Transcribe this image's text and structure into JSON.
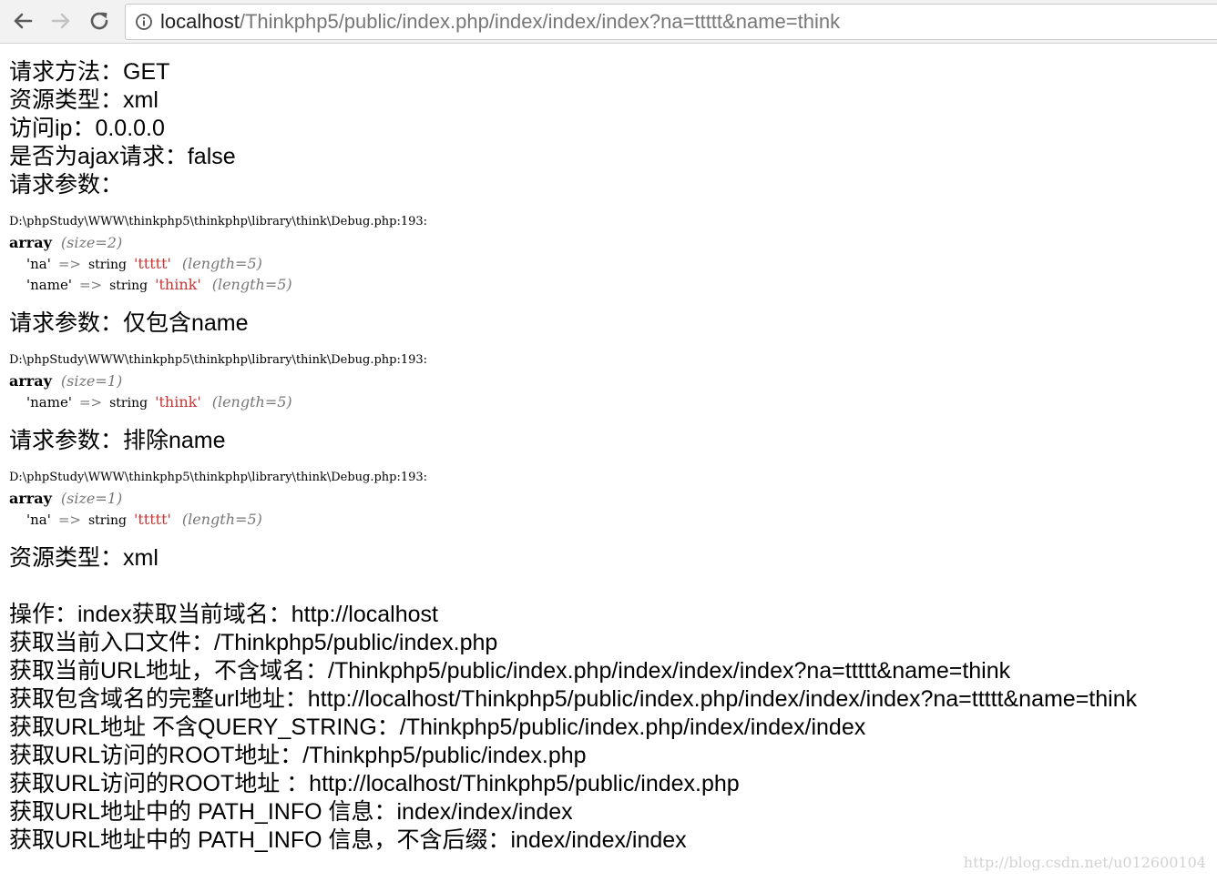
{
  "browser": {
    "url_host": "localhost",
    "url_rest": "/Thinkphp5/public/index.php/index/index/index?na=ttttt&name=think",
    "icons": {
      "back": "arrow-left-icon",
      "forward": "arrow-right-icon",
      "reload": "reload-icon",
      "info": "info-circle-icon"
    }
  },
  "lines_top": [
    "请求方法：GET",
    "资源类型：xml",
    "访问ip：0.0.0.0",
    "是否为ajax请求：false",
    "请求参数："
  ],
  "dump1": {
    "path": "D:\\phpStudy\\WWW\\thinkphp5\\thinkphp\\library\\think\\Debug.php:193:",
    "type_kw": "array",
    "size": "(size=2)",
    "entries": [
      {
        "key": "'na'",
        "arrow": "=>",
        "type": "string",
        "value": "'ttttt'",
        "length": "(length=5)"
      },
      {
        "key": "'name'",
        "arrow": "=>",
        "type": "string",
        "value": "'think'",
        "length": "(length=5)"
      }
    ]
  },
  "heading2": "请求参数：仅包含name",
  "dump2": {
    "path": "D:\\phpStudy\\WWW\\thinkphp5\\thinkphp\\library\\think\\Debug.php:193:",
    "type_kw": "array",
    "size": "(size=1)",
    "entries": [
      {
        "key": "'name'",
        "arrow": "=>",
        "type": "string",
        "value": "'think'",
        "length": "(length=5)"
      }
    ]
  },
  "heading3": "请求参数：排除name",
  "dump3": {
    "path": "D:\\phpStudy\\WWW\\thinkphp5\\thinkphp\\library\\think\\Debug.php:193:",
    "type_kw": "array",
    "size": "(size=1)",
    "entries": [
      {
        "key": "'na'",
        "arrow": "=>",
        "type": "string",
        "value": "'ttttt'",
        "length": "(length=5)"
      }
    ]
  },
  "resource_type": "资源类型：xml",
  "lines_bottom": [
    "操作：index获取当前域名：http://localhost",
    "获取当前入口文件：/Thinkphp5/public/index.php",
    "获取当前URL地址，不含域名：/Thinkphp5/public/index.php/index/index/index?na=ttttt&name=think",
    "获取包含域名的完整url地址：http://localhost/Thinkphp5/public/index.php/index/index/index?na=ttttt&name=think",
    "获取URL地址 不含QUERY_STRING：/Thinkphp5/public/index.php/index/index/index",
    "获取URL访问的ROOT地址：/Thinkphp5/public/index.php",
    "获取URL访问的ROOT地址 ：http://localhost/Thinkphp5/public/index.php",
    "获取URL地址中的 PATH_INFO 信息：index/index/index",
    "获取URL地址中的 PATH_INFO 信息，不含后缀：index/index/index"
  ],
  "watermark": "http://blog.csdn.net/u012600104"
}
